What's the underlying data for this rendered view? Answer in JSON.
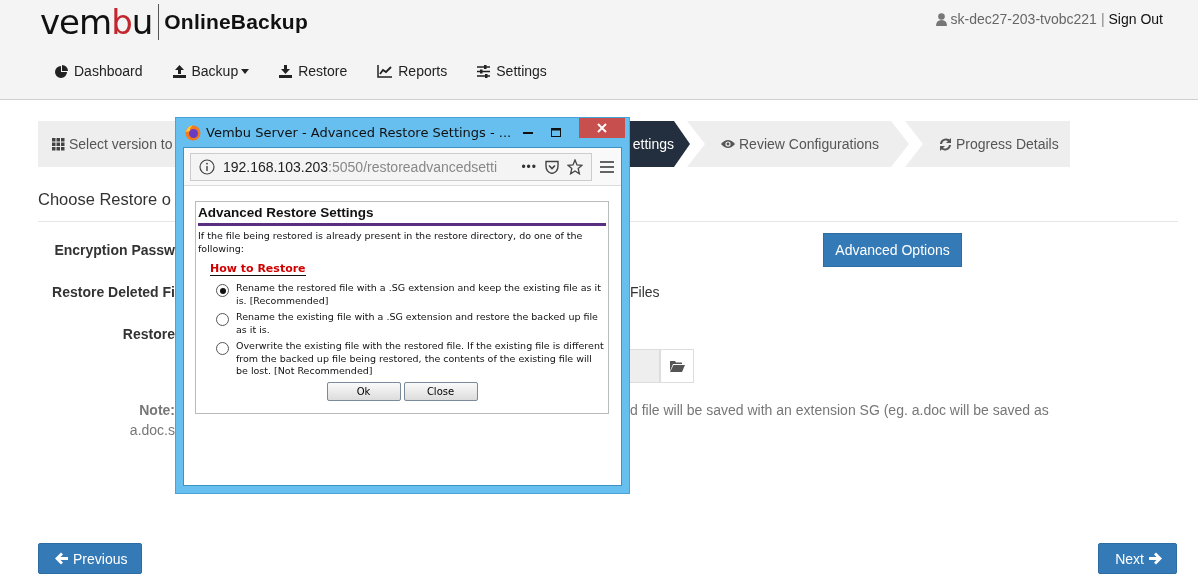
{
  "header": {
    "logo_parts": [
      "vem",
      "b",
      "u"
    ],
    "product": "OnlineBackup",
    "user": "sk-dec27-203-tvobc221",
    "separator": "|",
    "sign_out": "Sign Out"
  },
  "nav": [
    {
      "label": "Dashboard",
      "kind": "pie",
      "dropdown": false
    },
    {
      "label": "Backup",
      "kind": "upload",
      "dropdown": true
    },
    {
      "label": "Restore",
      "kind": "download",
      "dropdown": false
    },
    {
      "label": "Reports",
      "kind": "chart",
      "dropdown": false
    },
    {
      "label": "Settings",
      "kind": "sliders",
      "dropdown": false
    }
  ],
  "steps": [
    {
      "label": "Select version to",
      "kind": "grid",
      "selected": false
    },
    {
      "label": "ettings",
      "kind": "none",
      "selected": true
    },
    {
      "label": "Review Configurations",
      "kind": "eye",
      "selected": false
    },
    {
      "label": "Progress Details",
      "kind": "refresh",
      "selected": false
    }
  ],
  "section_title": "Choose Restore o",
  "form": {
    "encryption_label": "Encryption Passw",
    "advanced_button": "Advanced Options",
    "deleted_label": "Restore Deleted Fi",
    "deleted_value": "Files",
    "restore_label": "Restore",
    "note_label": "Note:",
    "note_text": "d file will be saved with an extension SG (eg. a.doc will be saved as",
    "note_text_2": "a.doc.s"
  },
  "dialog": {
    "title": "Vembu Server - Advanced Restore Settings - ...",
    "url_host": "192.168.103.203",
    "url_path": ":5050/restoreadvancedsetti",
    "more": "•••",
    "heading": "Advanced Restore Settings",
    "intro": "If the file being restored is already present in the restore directory, do one of the following:",
    "subheading": "How to Restore",
    "options": [
      {
        "text": "Rename the restored file with a .SG extension and keep the existing file as it is. [Recommended]",
        "selected": true
      },
      {
        "text": "Rename the existing file with a .SG extension and restore the backed up file as it is.",
        "selected": false
      },
      {
        "text": "Overwrite the existing file with the restored file. If the existing file is different from the backed up file being restored, the contents of the existing file will be lost. [Not Recommended]",
        "selected": false
      }
    ],
    "buttons": [
      "Ok",
      "Close"
    ]
  },
  "footer": {
    "previous": "Previous",
    "next": "Next"
  }
}
